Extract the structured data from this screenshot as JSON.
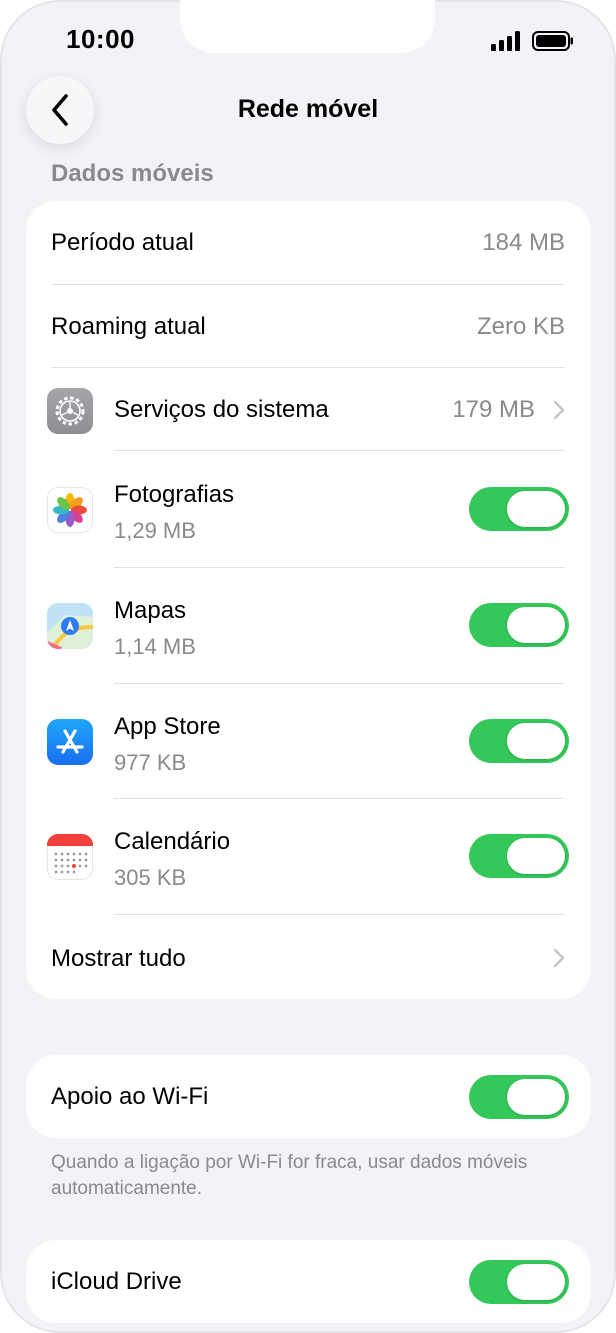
{
  "status": {
    "time": "10:00"
  },
  "nav": {
    "title": "Rede móvel"
  },
  "section": {
    "header": "Dados móveis"
  },
  "usage": [
    {
      "label": "Período atual",
      "value": "184 MB"
    },
    {
      "label": "Roaming atual",
      "value": "Zero KB"
    }
  ],
  "system_services": {
    "label": "Serviços do sistema",
    "value": "179 MB",
    "icon": "settings-gear-icon"
  },
  "apps": [
    {
      "name": "Fotografias",
      "usage": "1,29 MB",
      "icon": "photos-icon",
      "enabled": true
    },
    {
      "name": "Mapas",
      "usage": "1,14 MB",
      "icon": "maps-icon",
      "enabled": true
    },
    {
      "name": "App Store",
      "usage": "977 KB",
      "icon": "app-store-icon",
      "enabled": true
    },
    {
      "name": "Calendário",
      "usage": "305 KB",
      "icon": "calendar-icon",
      "enabled": true
    }
  ],
  "show_all": {
    "label": "Mostrar tudo"
  },
  "wifi_assist": {
    "label": "Apoio ao Wi-Fi",
    "enabled": true,
    "note": "Quando a ligação por Wi-Fi for fraca, usar dados móveis automaticamente."
  },
  "icloud_drive": {
    "label": "iCloud Drive",
    "enabled": true
  },
  "colors": {
    "toggle_on": "#34c759",
    "background": "#f2f2f7",
    "secondary_text": "#8a8a8e"
  }
}
